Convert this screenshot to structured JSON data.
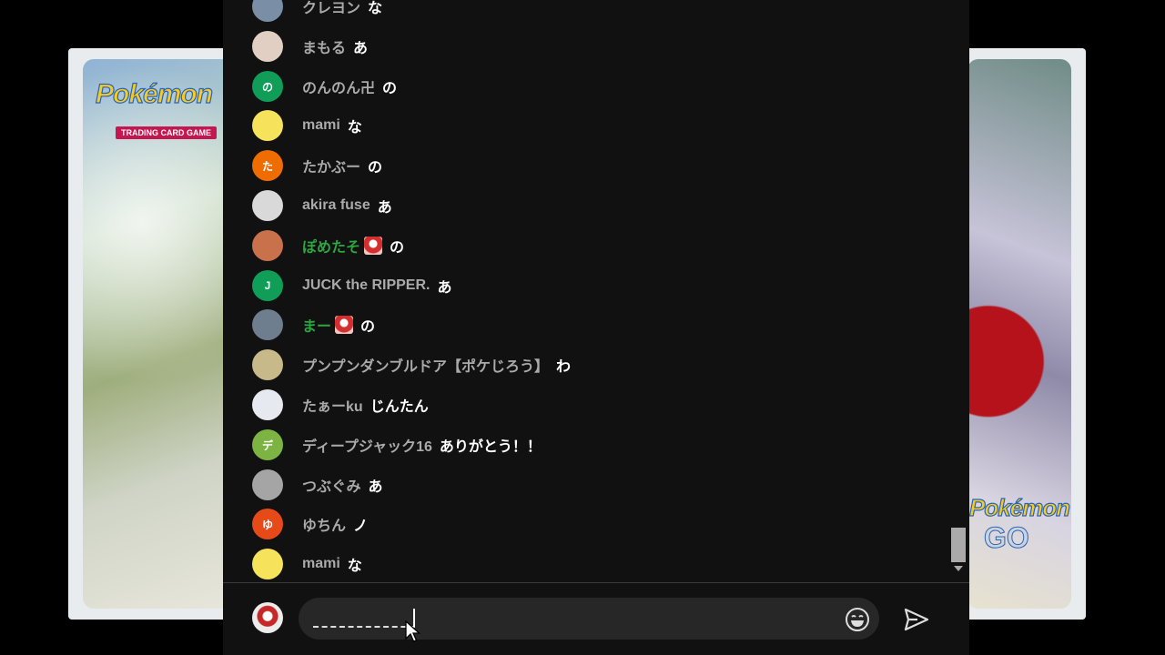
{
  "background_cards": {
    "left_logo": "Pokémon",
    "left_sublabel": "TRADING CARD GAME",
    "right_logo": "Pokémon",
    "right_sublabel": "GO"
  },
  "chat": {
    "messages": [
      {
        "author": "クレヨン",
        "text": "な",
        "avatar_color": "#7a8fa6",
        "avatar_letter": "",
        "member": false
      },
      {
        "author": "まもる",
        "text": "あ",
        "avatar_color": "#e0cfc2",
        "avatar_letter": "",
        "member": false
      },
      {
        "author": "のんのん卍",
        "text": "の",
        "avatar_color": "#0f9d58",
        "avatar_letter": "の",
        "member": false
      },
      {
        "author": "mami",
        "text": "な",
        "avatar_color": "#f7e25b",
        "avatar_letter": "",
        "member": false
      },
      {
        "author": "たかぶー",
        "text": "の",
        "avatar_color": "#ef6c00",
        "avatar_letter": "た",
        "member": false
      },
      {
        "author": "akira fuse",
        "text": "あ",
        "avatar_color": "#d9d9d9",
        "avatar_letter": "",
        "member": false
      },
      {
        "author": "ぽめたそ",
        "text": "の",
        "avatar_color": "#c9714a",
        "avatar_letter": "",
        "member": true
      },
      {
        "author": "JUCK the RIPPER.",
        "text": "あ",
        "avatar_color": "#0f9d58",
        "avatar_letter": "J",
        "member": false
      },
      {
        "author": "まー",
        "text": "の",
        "avatar_color": "#6f7e8f",
        "avatar_letter": "",
        "member": true
      },
      {
        "author": "プンプンダンブルドア【ポケじろう】",
        "text": "わ",
        "avatar_color": "#c8b98a",
        "avatar_letter": "",
        "member": false
      },
      {
        "author": "たぁーku",
        "text": "じんたん",
        "avatar_color": "#e6e9ef",
        "avatar_letter": "",
        "member": false
      },
      {
        "author": "ディープジャック16",
        "text": "ありがとう！！",
        "avatar_color": "#7cb342",
        "avatar_letter": "デ",
        "member": false
      },
      {
        "author": "つぶぐみ",
        "text": "あ",
        "avatar_color": "#a5a5a5",
        "avatar_letter": "",
        "member": false
      },
      {
        "author": "ゆちん",
        "text": "ノ",
        "avatar_color": "#e64a19",
        "avatar_letter": "ゆ",
        "member": false
      },
      {
        "author": "mami",
        "text": "な",
        "avatar_color": "#f7e25b",
        "avatar_letter": "",
        "member": false
      }
    ]
  },
  "composer": {
    "input_value": "",
    "placeholder": "",
    "emoji_icon": "smiley-icon",
    "send_icon": "send-icon"
  },
  "colors": {
    "panel_bg": "#111111",
    "author": "#aaaaaa",
    "member_author": "#2ba640",
    "message_text": "#ffffff"
  }
}
